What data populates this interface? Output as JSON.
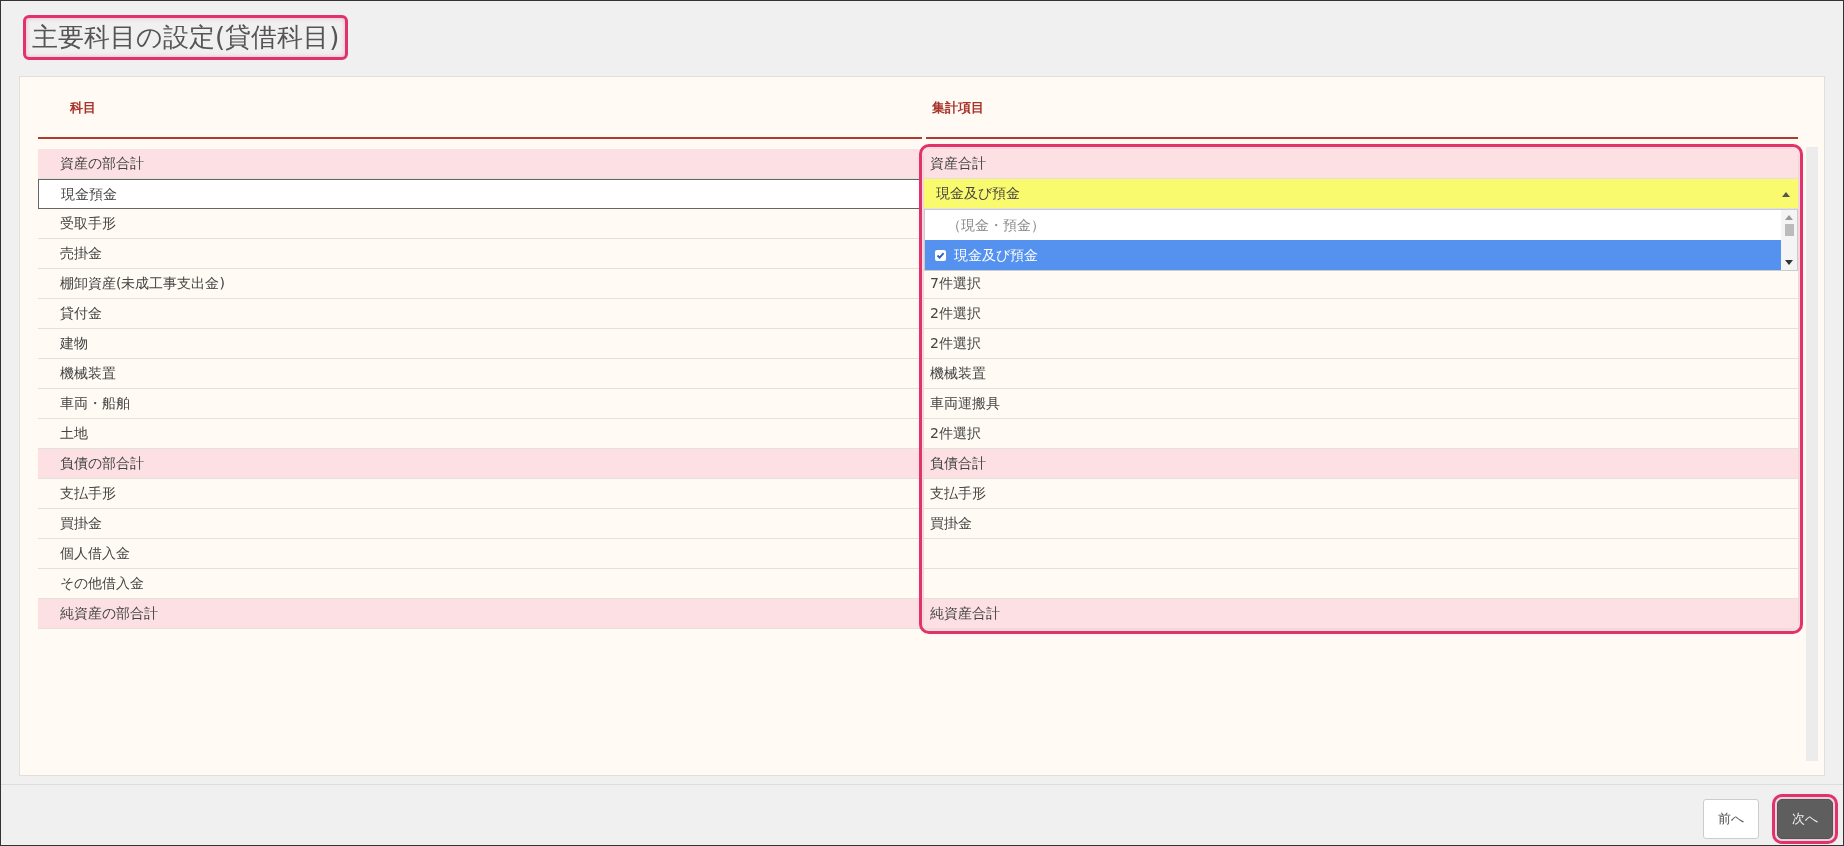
{
  "title": {
    "text": "主要科目の設定(貸借科目)",
    "callout": true
  },
  "table": {
    "columns": [
      "科目",
      "集計項目"
    ],
    "summary_callout": true,
    "rows": [
      {
        "kind": "section",
        "account": "資産の部合計",
        "total": "資産合計",
        "selected": false
      },
      {
        "kind": "item",
        "account": "現金預金",
        "total": "現金及び預金",
        "selected": true,
        "dropdown": {
          "open": true,
          "options": [
            {
              "kind": "group",
              "label": "（現金・預金）"
            },
            {
              "kind": "option",
              "label": "現金及び預金",
              "checked": true,
              "selected": true
            }
          ]
        }
      },
      {
        "kind": "item",
        "account": "受取手形",
        "selected": false
      },
      {
        "kind": "item",
        "account": "売掛金",
        "selected": false
      },
      {
        "kind": "item",
        "account": "棚卸資産(未成工事支出金)",
        "total": "7件選択",
        "selected": false
      },
      {
        "kind": "item",
        "account": "貸付金",
        "total": "2件選択",
        "selected": false
      },
      {
        "kind": "item",
        "account": "建物",
        "total": "2件選択",
        "selected": false
      },
      {
        "kind": "item",
        "account": "機械装置",
        "total": "機械装置",
        "selected": false
      },
      {
        "kind": "item",
        "account": "車両・船舶",
        "total": "車両運搬具",
        "selected": false
      },
      {
        "kind": "item",
        "account": "土地",
        "total": "2件選択",
        "selected": false
      },
      {
        "kind": "section",
        "account": "負債の部合計",
        "total": "負債合計",
        "selected": false
      },
      {
        "kind": "item",
        "account": "支払手形",
        "total": "支払手形",
        "selected": false
      },
      {
        "kind": "item",
        "account": "買掛金",
        "total": "買掛金",
        "selected": false
      },
      {
        "kind": "item",
        "account": "個人借入金",
        "selected": false
      },
      {
        "kind": "item",
        "account": "その他借入金",
        "selected": false
      },
      {
        "kind": "section",
        "account": "純資産の部合計",
        "total": "純資産合計",
        "selected": false
      }
    ]
  },
  "buttons": [
    {
      "label": "前へ",
      "kind": "secondary",
      "callout": false
    },
    {
      "label": "次へ",
      "kind": "primary",
      "callout": true
    }
  ]
}
